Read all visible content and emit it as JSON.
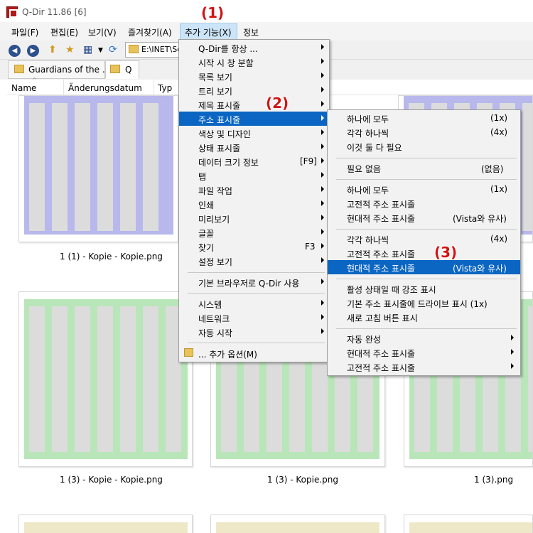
{
  "window": {
    "title": "Q-Dir 11.86 [6]"
  },
  "menubar": [
    "파일(F)",
    "편집(E)",
    "보기(V)",
    "즐겨찾기(A)",
    "추가 기능(X)",
    "정보"
  ],
  "toolbar": {
    "icons": [
      "back-arrow-icon",
      "forward-arrow-icon",
      "up-folder-icon",
      "new-folder-icon",
      "view-mode-icon",
      "refresh-icon"
    ],
    "path": "E:\\INET\\Sc"
  },
  "tabs": [
    "Guardians of the ...",
    "Q"
  ],
  "columns": [
    "Name",
    "Änderungsdatum",
    "Typ"
  ],
  "thumbnails": [
    {
      "label": "1 (1) - Kopie - Kopie.png"
    },
    {
      "label": "1 (3) - Kopie - Kopie.png"
    },
    {
      "label": "1 (3) - Kopie.png"
    },
    {
      "label": "1 (3).png"
    }
  ],
  "menu_main": {
    "group1": [
      {
        "label": "Q-Dir를 항상 ...",
        "arrow": true
      },
      {
        "label": "시작 시 창 분할",
        "arrow": true
      },
      {
        "label": "목록 보기",
        "arrow": true
      },
      {
        "label": "트리 보기",
        "arrow": true
      },
      {
        "label": "제목 표시줄",
        "arrow": true
      },
      {
        "label": "주소 표시줄",
        "arrow": true
      },
      {
        "label": "색상 및 디자인",
        "arrow": true
      },
      {
        "label": "상태 표시줄",
        "arrow": true
      },
      {
        "label": "데이터 크기 정보",
        "shortcut": "[F9]",
        "arrow": true
      },
      {
        "label": "탭",
        "arrow": true
      },
      {
        "label": "파일 작업",
        "arrow": true
      },
      {
        "label": "인쇄",
        "arrow": true
      },
      {
        "label": "미리보기",
        "arrow": true
      },
      {
        "label": "글꼴",
        "arrow": true
      },
      {
        "label": "찾기",
        "shortcut": "F3",
        "arrow": true
      },
      {
        "label": "설정 보기",
        "arrow": true
      }
    ],
    "group2": [
      {
        "label": "기본 브라우저로 Q-Dir 사용",
        "arrow": true
      }
    ],
    "group3": [
      {
        "label": "시스템",
        "arrow": true
      },
      {
        "label": "네트워크",
        "arrow": true
      },
      {
        "label": "자동 시작",
        "arrow": true
      }
    ],
    "group4": [
      {
        "label": "... 추가 옵션(M)"
      }
    ]
  },
  "menu_sub": {
    "group1": [
      {
        "label": "하나에 모두",
        "shortcut": "(1x)"
      },
      {
        "label": "각각 하나씩",
        "shortcut": "(4x)"
      },
      {
        "label": "이것 둘 다 필요"
      }
    ],
    "group2": [
      {
        "label": "필요 없음",
        "shortcut": "(없음)"
      }
    ],
    "group3": [
      {
        "label": "하나에 모두",
        "shortcut": "(1x)"
      },
      {
        "label": "고전적 주소 표시줄"
      },
      {
        "label": "현대적 주소 표시줄",
        "shortcut": "(Vista와 유사)"
      }
    ],
    "group4": [
      {
        "label": "각각 하나씩",
        "shortcut": "(4x)"
      },
      {
        "label": "고전적 주소 표시줄"
      },
      {
        "label": "현대적 주소 표시줄",
        "shortcut": "(Vista와 유사)"
      }
    ],
    "group5": [
      {
        "label": "활성 상태일 때 강조 표시"
      },
      {
        "label": "기본 주소 표시줄에 드라이브 표시 (1x)"
      },
      {
        "label": "새로 고침 버튼 표시"
      }
    ],
    "group6": [
      {
        "label": "자동 완성",
        "arrow": true
      },
      {
        "label": "현대적 주소 표시줄",
        "arrow": true
      },
      {
        "label": "고전적 주소 표시줄",
        "arrow": true
      }
    ]
  },
  "annotations": [
    "(1)",
    "(2)",
    "(3)"
  ],
  "colors": {
    "highlight": "#0a66c2",
    "annotation": "#d21414",
    "thumb_purple": "#b8b8ec",
    "thumb_green": "#b9e6b9",
    "thumb_yellow": "#eee8c8"
  }
}
